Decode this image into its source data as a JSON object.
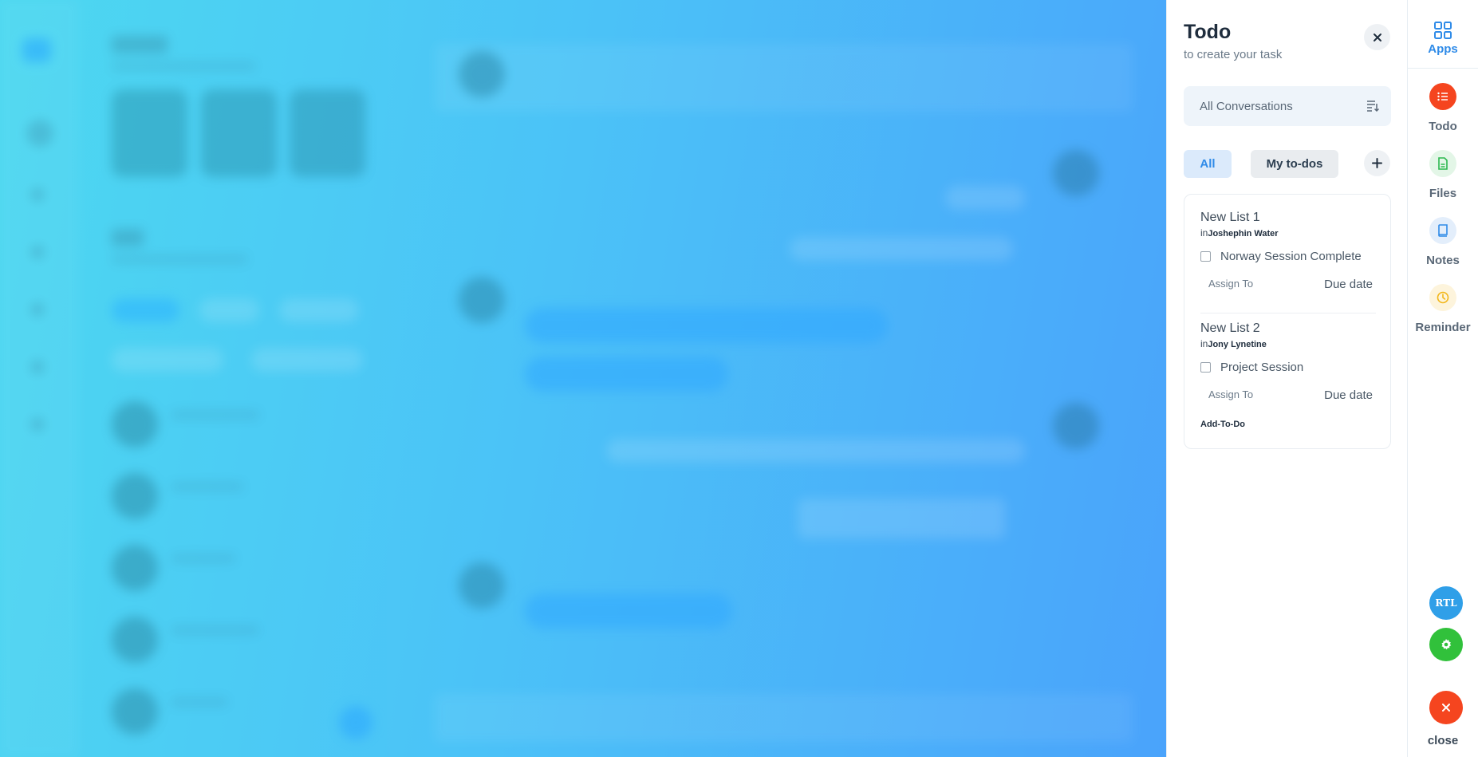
{
  "todo": {
    "title": "Todo",
    "subtitle": "to create your task",
    "close_icon": "close-icon",
    "conversation_filter": {
      "label": "All Conversations",
      "icon": "sort-list-icon"
    },
    "tabs": [
      {
        "label": "All",
        "active": true
      },
      {
        "label": "My to-dos",
        "active": false
      }
    ],
    "add_icon": "plus-icon",
    "lists": [
      {
        "name": "New List 1",
        "in_prefix": "in",
        "conversation": "Joshephin Water",
        "task": "Norway Session Complete",
        "assign_label": "Assign To",
        "due_label": "Due date"
      },
      {
        "name": "New List 2",
        "in_prefix": "in",
        "conversation": "Jony Lynetine",
        "task": "Project Session",
        "assign_label": "Assign To",
        "due_label": "Due date"
      }
    ],
    "add_todo_label": "Add-To-Do"
  },
  "rail": {
    "apps_label": "Apps",
    "items": [
      {
        "label": "Todo",
        "icon": "list-icon",
        "color": "#f5451f",
        "bg": "#f5451f"
      },
      {
        "label": "Files",
        "icon": "file-icon",
        "color": "#2cb84f",
        "bg": "#e3f6e7"
      },
      {
        "label": "Notes",
        "icon": "book-icon",
        "color": "#2f8be8",
        "bg": "#e3eefb"
      },
      {
        "label": "Reminder",
        "icon": "clock-icon",
        "color": "#f2b71b",
        "bg": "#fdf4dc"
      }
    ],
    "rtl_label": "RTL",
    "close_label": "close"
  },
  "colors": {
    "accent": "#2f8be8",
    "rtl": "#2f9fe8",
    "settings": "#31c13b",
    "close": "#f5451f"
  }
}
